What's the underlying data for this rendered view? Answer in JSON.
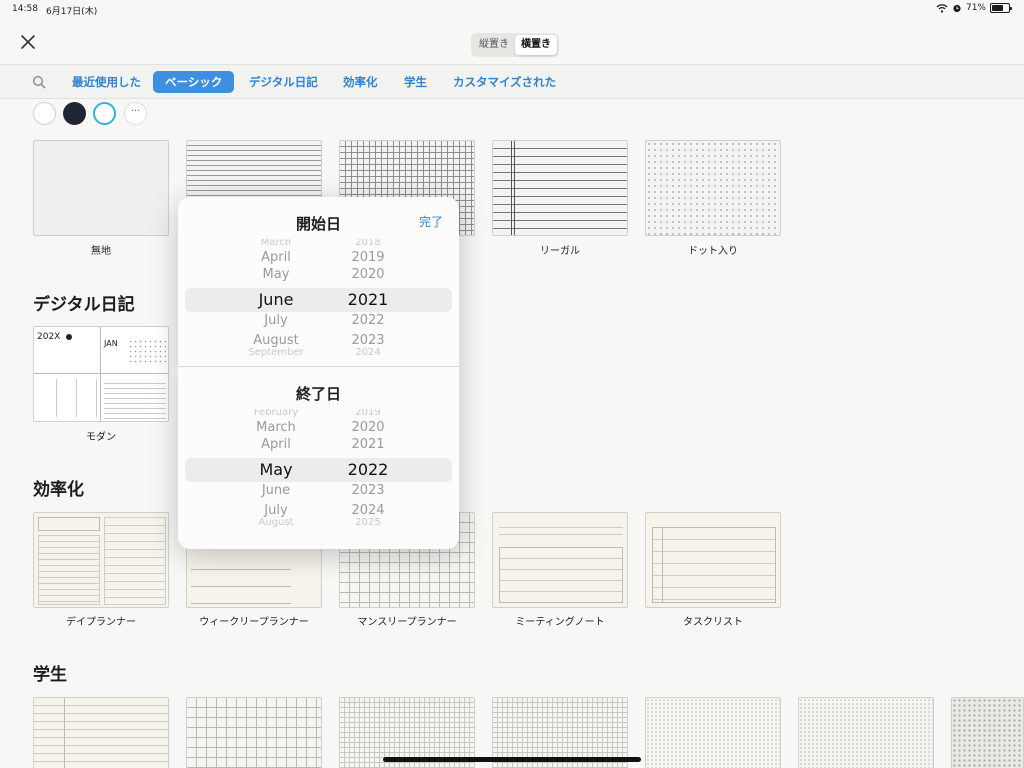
{
  "status": {
    "time": "14:58",
    "date": "6月17日(木)",
    "battery": "71%",
    "battery_level": 0.71
  },
  "orientation": {
    "portrait": "縦置き",
    "landscape": "横置き",
    "selected": "横置き"
  },
  "tabs": [
    "最近使用した",
    "ベーシック",
    "デジタル日記",
    "効率化",
    "学生",
    "カスタマイズされた"
  ],
  "active_tab": "ベーシック",
  "swatches": [
    "#ffffff",
    "#1f2533",
    "#ffffff"
  ],
  "basic": {
    "items": [
      "無地",
      "",
      "",
      "リーガル",
      "ドット入り"
    ]
  },
  "journal": {
    "title": "デジタル日記",
    "item_label": "モダン",
    "thumb_year": "202X",
    "thumb_month": "JAN"
  },
  "productivity": {
    "title": "効率化",
    "items": [
      "デイプランナー",
      "ウィークリープランナー",
      "マンスリープランナー",
      "ミーティングノート",
      "タスクリスト"
    ]
  },
  "student": {
    "title": "学生"
  },
  "picker": {
    "done": "完了",
    "start": {
      "title": "開始日",
      "months": [
        "March",
        "April",
        "May",
        "June",
        "July",
        "August",
        "September"
      ],
      "years": [
        "2018",
        "2019",
        "2020",
        "2021",
        "2022",
        "2023",
        "2024"
      ]
    },
    "end": {
      "title": "終了日",
      "months": [
        "February",
        "March",
        "April",
        "May",
        "June",
        "July",
        "August"
      ],
      "years": [
        "2019",
        "2020",
        "2021",
        "2022",
        "2023",
        "2024",
        "2025"
      ]
    }
  }
}
